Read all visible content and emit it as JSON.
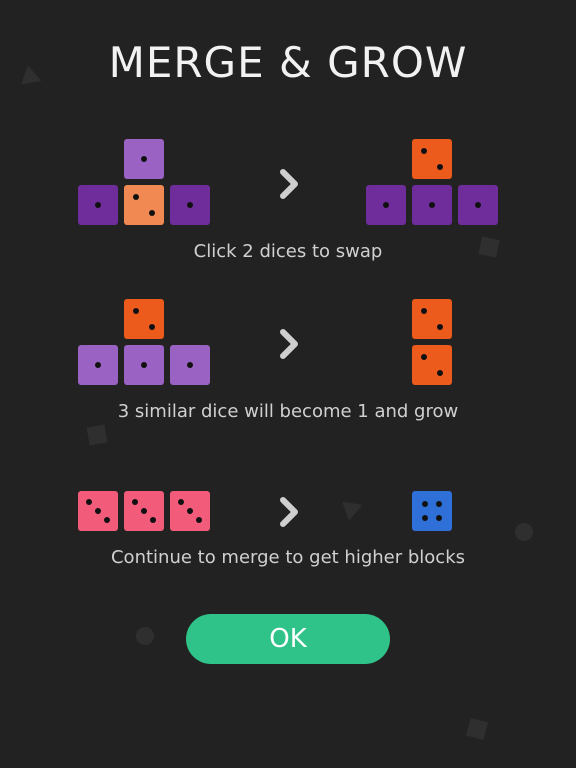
{
  "title": "MERGE & GROW",
  "colors": {
    "background": "#222222",
    "dark_purple": "#6e2d9b",
    "light_orange": "#f08a52",
    "orange": "#ec5a1c",
    "light_purple": "#9a62c2",
    "pink": "#f25c7a",
    "blue": "#2f6fd8",
    "ok_green": "#2fc389"
  },
  "steps": [
    {
      "caption": "Click 2 dices to swap",
      "before": [
        {
          "value": 1,
          "color": "light_purple"
        },
        {
          "value": 1,
          "color": "dark_purple"
        },
        {
          "value": 2,
          "color": "light_orange"
        },
        {
          "value": 1,
          "color": "dark_purple"
        }
      ],
      "after": [
        {
          "value": 2,
          "color": "orange"
        },
        {
          "value": 1,
          "color": "dark_purple"
        },
        {
          "value": 1,
          "color": "dark_purple"
        },
        {
          "value": 1,
          "color": "dark_purple"
        }
      ]
    },
    {
      "caption": "3 similar dice will become 1 and grow",
      "before": [
        {
          "value": 2,
          "color": "orange"
        },
        {
          "value": 1,
          "color": "light_purple"
        },
        {
          "value": 1,
          "color": "light_purple"
        },
        {
          "value": 1,
          "color": "light_purple"
        }
      ],
      "after": [
        {
          "value": 2,
          "color": "orange"
        },
        {
          "value": 2,
          "color": "orange"
        }
      ]
    },
    {
      "caption": "Continue to merge to get higher blocks",
      "before": [
        {
          "value": 3,
          "color": "pink"
        },
        {
          "value": 3,
          "color": "pink"
        },
        {
          "value": 3,
          "color": "pink"
        }
      ],
      "after": [
        {
          "value": 4,
          "color": "blue"
        }
      ]
    }
  ],
  "arrow_icon": "chevron-right-icon",
  "ok_label": "OK"
}
